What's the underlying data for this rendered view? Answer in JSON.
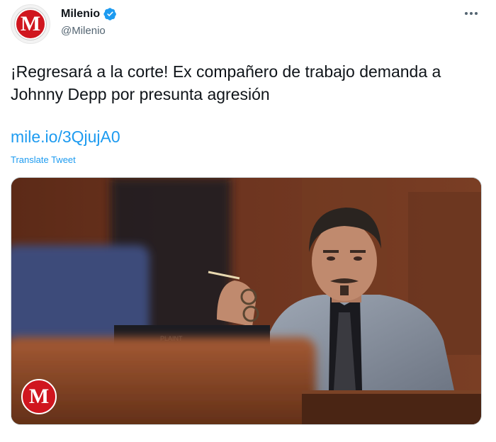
{
  "account": {
    "display_name": "Milenio",
    "handle": "@Milenio",
    "avatar_letter": "M",
    "verified": true,
    "brand_color": "#d0161f"
  },
  "tweet": {
    "text": "¡Regresará a la corte! Ex compañero de trabajo demanda a Johnny Depp por presunta agresión",
    "link": "mile.io/3QjujA0",
    "translate_label": "Translate Tweet"
  },
  "media": {
    "watermark_letter": "M",
    "plaque_text": "PLAINT"
  },
  "icons": {
    "verified": "verified-badge-icon",
    "more": "more-options-icon"
  },
  "colors": {
    "link": "#1d9bf0",
    "secondary_text": "#536471"
  }
}
